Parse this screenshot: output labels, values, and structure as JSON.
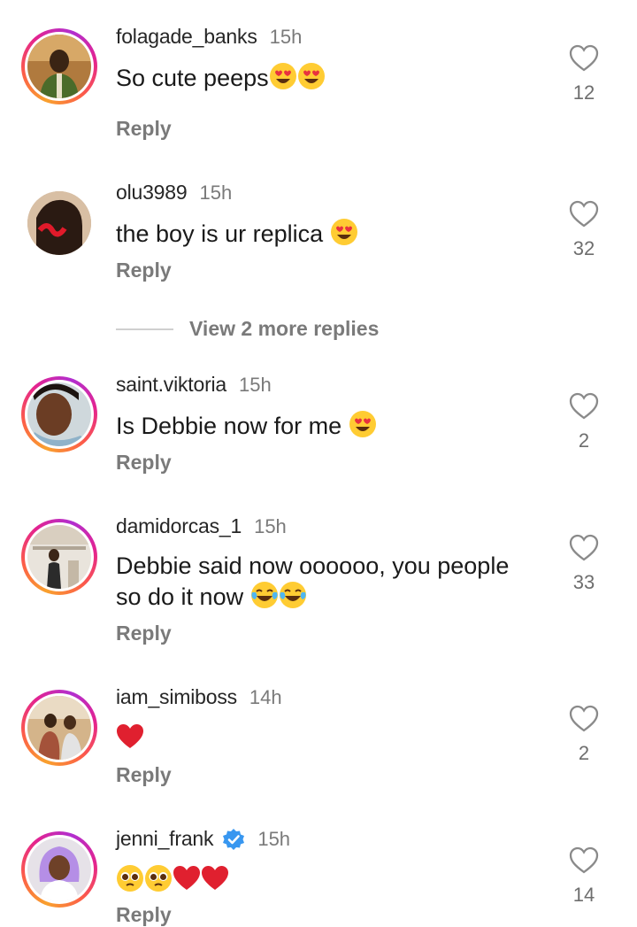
{
  "comments": [
    {
      "username": "folagade_banks",
      "time": "15h",
      "text": "So cute peeps",
      "emojis": [
        "heart-eyes",
        "heart-eyes"
      ],
      "likes": "12",
      "reply": "Reply"
    },
    {
      "username": "olu3989",
      "time": "15h",
      "text": "the boy is ur replica ",
      "emojis": [
        "heart-eyes"
      ],
      "likes": "32",
      "reply": "Reply"
    },
    {
      "username": "saint.viktoria",
      "time": "15h",
      "text": "Is Debbie now for me ",
      "emojis": [
        "heart-eyes"
      ],
      "likes": "2",
      "reply": "Reply"
    },
    {
      "username": "damidorcas_1",
      "time": "15h",
      "text": "Debbie said now oooooo, you people so do it now ",
      "emojis": [
        "tears-of-joy",
        "tears-of-joy"
      ],
      "likes": "33",
      "reply": "Reply"
    },
    {
      "username": "iam_simiboss",
      "time": "14h",
      "text": "",
      "emojis": [
        "red-heart"
      ],
      "likes": "2",
      "reply": "Reply"
    },
    {
      "username": "jenni_frank",
      "time": "15h",
      "text": "",
      "emojis": [
        "pleading",
        "pleading",
        "red-heart",
        "red-heart"
      ],
      "likes": "14",
      "reply": "Reply",
      "verified": true
    }
  ],
  "view_more": {
    "label": "View 2 more replies"
  },
  "colors": {
    "ring_gradient": [
      "#f9a12e",
      "#fc5c49",
      "#e4238f",
      "#b12fd0"
    ],
    "verified_blue": "#3897f0",
    "muted_text": "#7a7a7a"
  }
}
